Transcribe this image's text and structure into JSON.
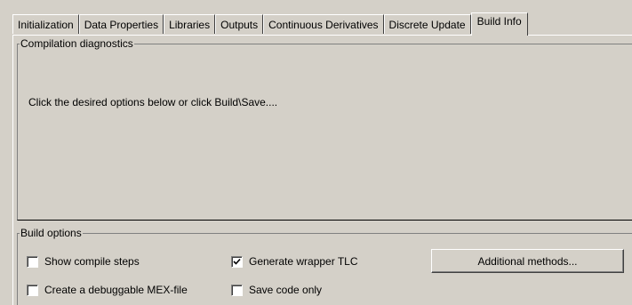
{
  "tabs": [
    {
      "label": "Initialization",
      "active": false
    },
    {
      "label": "Data Properties",
      "active": false
    },
    {
      "label": "Libraries",
      "active": false
    },
    {
      "label": "Outputs",
      "active": false
    },
    {
      "label": "Continuous Derivatives",
      "active": false
    },
    {
      "label": "Discrete Update",
      "active": false
    },
    {
      "label": "Build Info",
      "active": true
    }
  ],
  "diagnostics": {
    "title": "Compilation diagnostics",
    "message": "Click the desired options below or click Build\\Save...."
  },
  "build_options": {
    "title": "Build options",
    "show_compile_steps": {
      "label": "Show compile steps",
      "checked": false
    },
    "generate_wrapper_tlc": {
      "label": "Generate wrapper TLC",
      "checked": true
    },
    "create_debuggable_mex": {
      "label": "Create a debuggable MEX-file",
      "checked": false
    },
    "save_code_only": {
      "label": "Save code only",
      "checked": false
    },
    "additional_methods_label": "Additional methods..."
  }
}
